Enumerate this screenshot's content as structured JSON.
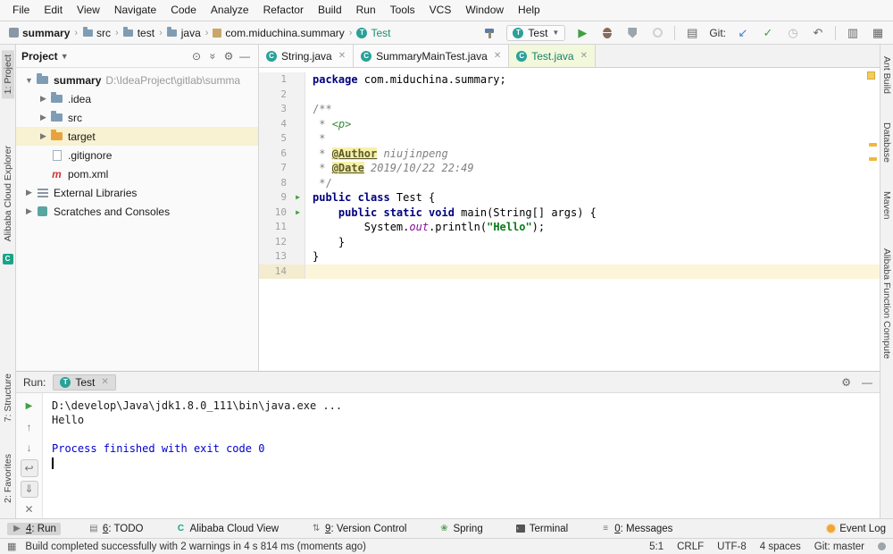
{
  "colors": {
    "run_green": "#3fa13f",
    "warning_orange": "#f0b73f",
    "test_teal": "#15826b",
    "keyword_navy": "#000080",
    "string_green": "#067d17",
    "selection_cream": "#f8f1d2"
  },
  "menu": {
    "items": [
      "File",
      "Edit",
      "View",
      "Navigate",
      "Code",
      "Analyze",
      "Refactor",
      "Build",
      "Run",
      "Tools",
      "VCS",
      "Window",
      "Help"
    ]
  },
  "navbar": {
    "breadcrumbs": [
      {
        "label": "summary",
        "icon": "project",
        "bold": true
      },
      {
        "label": "src",
        "icon": "folder"
      },
      {
        "label": "test",
        "icon": "folder"
      },
      {
        "label": "java",
        "icon": "folder"
      },
      {
        "label": "com.miduchina.summary",
        "icon": "package"
      },
      {
        "label": "Test",
        "icon": "class",
        "accent": true
      }
    ],
    "run_config": "Test",
    "git_label": "Git:"
  },
  "left_stripe": {
    "items": [
      {
        "label": "1: Project",
        "active": true
      },
      {
        "label": "Alibaba Cloud Explorer"
      },
      {
        "label": "7: Structure"
      },
      {
        "label": "2: Favorites"
      }
    ]
  },
  "right_stripe": {
    "items": [
      {
        "label": "Ant Build"
      },
      {
        "label": "Database"
      },
      {
        "label": "Maven"
      },
      {
        "label": "Alibaba Function Compute"
      }
    ]
  },
  "project": {
    "title": "Project",
    "tree": [
      {
        "label": "summary",
        "detail": "D:\\IdeaProject\\gitlab\\summa",
        "icon": "folder",
        "chev": "down",
        "indent": 0,
        "bold": true
      },
      {
        "label": ".idea",
        "icon": "folder",
        "chev": "right",
        "indent": 1
      },
      {
        "label": "src",
        "icon": "folder",
        "chev": "right",
        "indent": 1
      },
      {
        "label": "target",
        "icon": "folder-orange",
        "chev": "right",
        "indent": 1,
        "selected": true
      },
      {
        "label": ".gitignore",
        "icon": "file",
        "indent": 1
      },
      {
        "label": "pom.xml",
        "icon": "maven",
        "indent": 1
      },
      {
        "label": "External Libraries",
        "icon": "lib",
        "chev": "right",
        "indent": 0
      },
      {
        "label": "Scratches and Consoles",
        "icon": "scratch",
        "chev": "right",
        "indent": 0
      }
    ]
  },
  "editor": {
    "tabs": [
      {
        "label": "String.java"
      },
      {
        "label": "SummaryMainTest.java"
      },
      {
        "label": "Test.java",
        "active": true
      }
    ],
    "lines": [
      {
        "num": 1,
        "segs": [
          {
            "c": "kw",
            "t": "package"
          },
          {
            "c": "plain",
            "t": " com.miduchina.summary;"
          }
        ]
      },
      {
        "num": 2,
        "segs": []
      },
      {
        "num": 3,
        "segs": [
          {
            "c": "cmt",
            "t": "/**"
          }
        ]
      },
      {
        "num": 4,
        "segs": [
          {
            "c": "cmt",
            "t": " * "
          },
          {
            "c": "docmark",
            "t": "<p>"
          }
        ]
      },
      {
        "num": 5,
        "segs": [
          {
            "c": "cmt",
            "t": " *"
          }
        ]
      },
      {
        "num": 6,
        "segs": [
          {
            "c": "cmt",
            "t": " * "
          },
          {
            "c": "doctag",
            "t": "@Author"
          },
          {
            "c": "docval",
            "t": " niujinpeng"
          }
        ]
      },
      {
        "num": 7,
        "segs": [
          {
            "c": "cmt",
            "t": " * "
          },
          {
            "c": "doctag",
            "t": "@Date"
          },
          {
            "c": "docval",
            "t": " 2019/10/22 22:49"
          }
        ]
      },
      {
        "num": 8,
        "segs": [
          {
            "c": "cmt",
            "t": " */"
          }
        ]
      },
      {
        "num": 9,
        "marker": "run",
        "segs": [
          {
            "c": "kw",
            "t": "public class"
          },
          {
            "c": "plain",
            "t": " Test {"
          }
        ]
      },
      {
        "num": 10,
        "marker": "run",
        "segs": [
          {
            "c": "plain",
            "t": "    "
          },
          {
            "c": "kw",
            "t": "public static void"
          },
          {
            "c": "plain",
            "t": " main(String[] args) {"
          }
        ]
      },
      {
        "num": 11,
        "segs": [
          {
            "c": "plain",
            "t": "        System."
          },
          {
            "c": "field",
            "t": "out"
          },
          {
            "c": "plain",
            "t": ".println("
          },
          {
            "c": "str",
            "t": "\"Hello\""
          },
          {
            "c": "plain",
            "t": ");"
          }
        ]
      },
      {
        "num": 12,
        "segs": [
          {
            "c": "plain",
            "t": "    }"
          }
        ]
      },
      {
        "num": 13,
        "segs": [
          {
            "c": "plain",
            "t": "}"
          }
        ]
      },
      {
        "num": 14,
        "segs": [],
        "highlight": true
      }
    ]
  },
  "run": {
    "label": "Run:",
    "tab": "Test",
    "console": [
      {
        "c": "plain",
        "t": "D:\\develop\\Java\\jdk1.8.0_111\\bin\\java.exe ..."
      },
      {
        "c": "plain",
        "t": "Hello"
      },
      {
        "c": "plain",
        "t": ""
      },
      {
        "c": "sys",
        "t": "Process finished with exit code 0"
      }
    ]
  },
  "bottom": {
    "items": [
      {
        "num": "4",
        "label": "Run",
        "icon": "run",
        "active": true
      },
      {
        "num": "6",
        "label": "TODO",
        "icon": "todo"
      },
      {
        "label": "Alibaba Cloud View",
        "icon": "alibaba"
      },
      {
        "num": "9",
        "label": "Version Control",
        "icon": "vcs"
      },
      {
        "label": "Spring",
        "icon": "spring"
      },
      {
        "label": "Terminal",
        "icon": "terminal"
      },
      {
        "num": "0",
        "label": "Messages",
        "icon": "messages"
      }
    ],
    "event_log": "Event Log"
  },
  "status": {
    "message": "Build completed successfully with 2 warnings in 4 s 814 ms (moments ago)",
    "items": [
      "5:1",
      "CRLF",
      "UTF-8",
      "4 spaces",
      "Git: master"
    ]
  }
}
